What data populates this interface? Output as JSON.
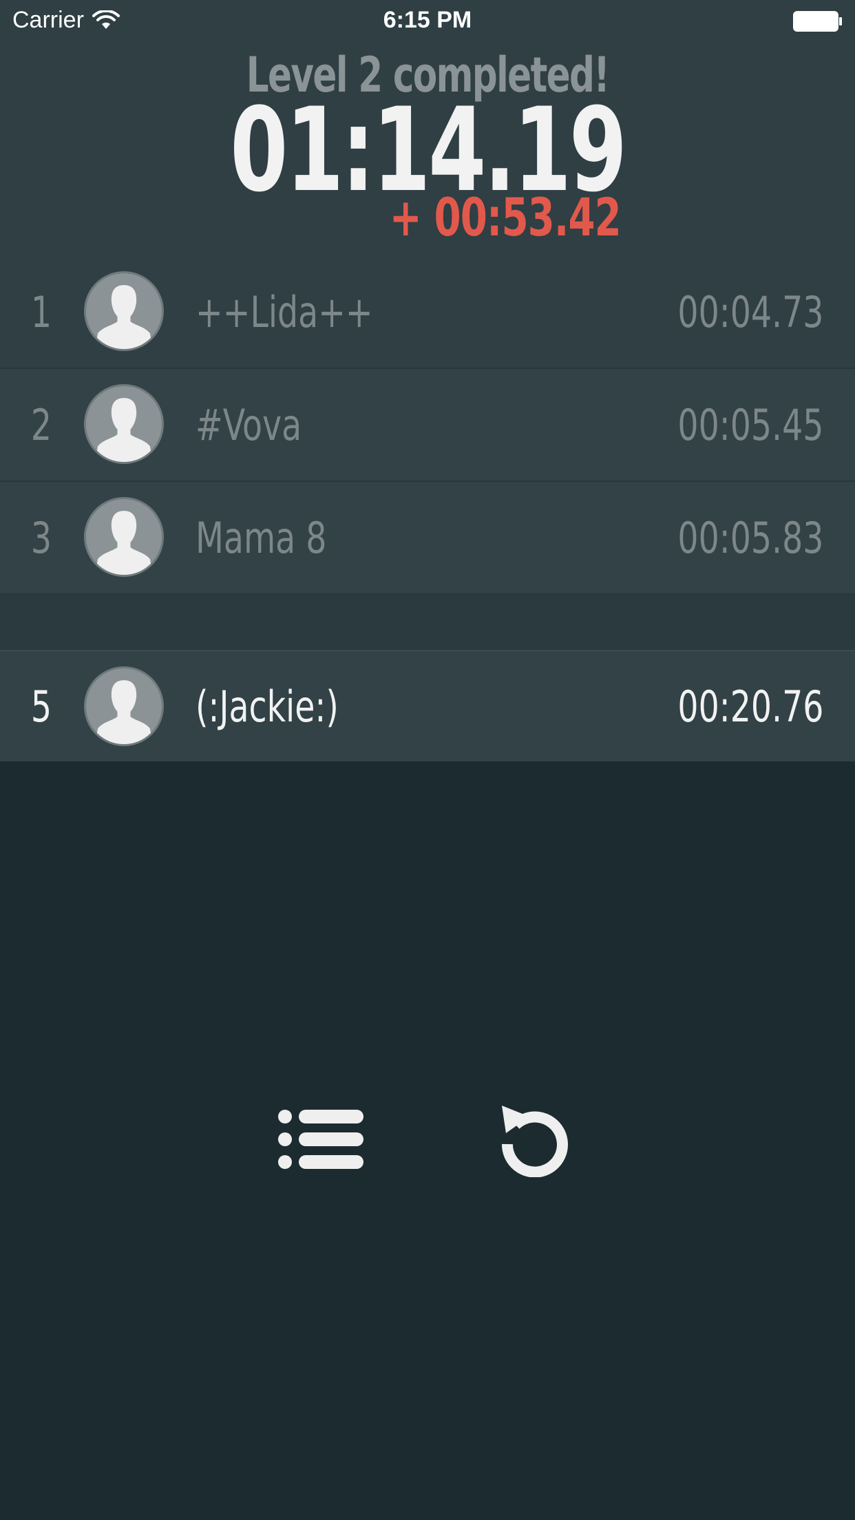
{
  "status_bar": {
    "carrier": "Carrier",
    "time": "6:15 PM"
  },
  "header": {
    "title": "Level 2 completed!",
    "time": "01:14.19",
    "delta": "+ 00:53.42",
    "delta_color": "#e2594c"
  },
  "leaderboard": [
    {
      "rank": "1",
      "name": "++Lida++",
      "time": "00:04.73",
      "avatar_icon": "user-silhouette-icon"
    },
    {
      "rank": "2",
      "name": "#Vova",
      "time": "00:05.45",
      "avatar_icon": "user-silhouette-icon"
    },
    {
      "rank": "3",
      "name": "Mama 8",
      "time": "00:05.83",
      "avatar_icon": "user-silhouette-icon"
    }
  ],
  "current_player": {
    "rank": "5",
    "name": "(:Jackie:)",
    "time": "00:20.76",
    "avatar_icon": "user-silhouette-icon"
  },
  "controls": {
    "list_icon": "list-icon",
    "replay_icon": "replay-icon"
  }
}
